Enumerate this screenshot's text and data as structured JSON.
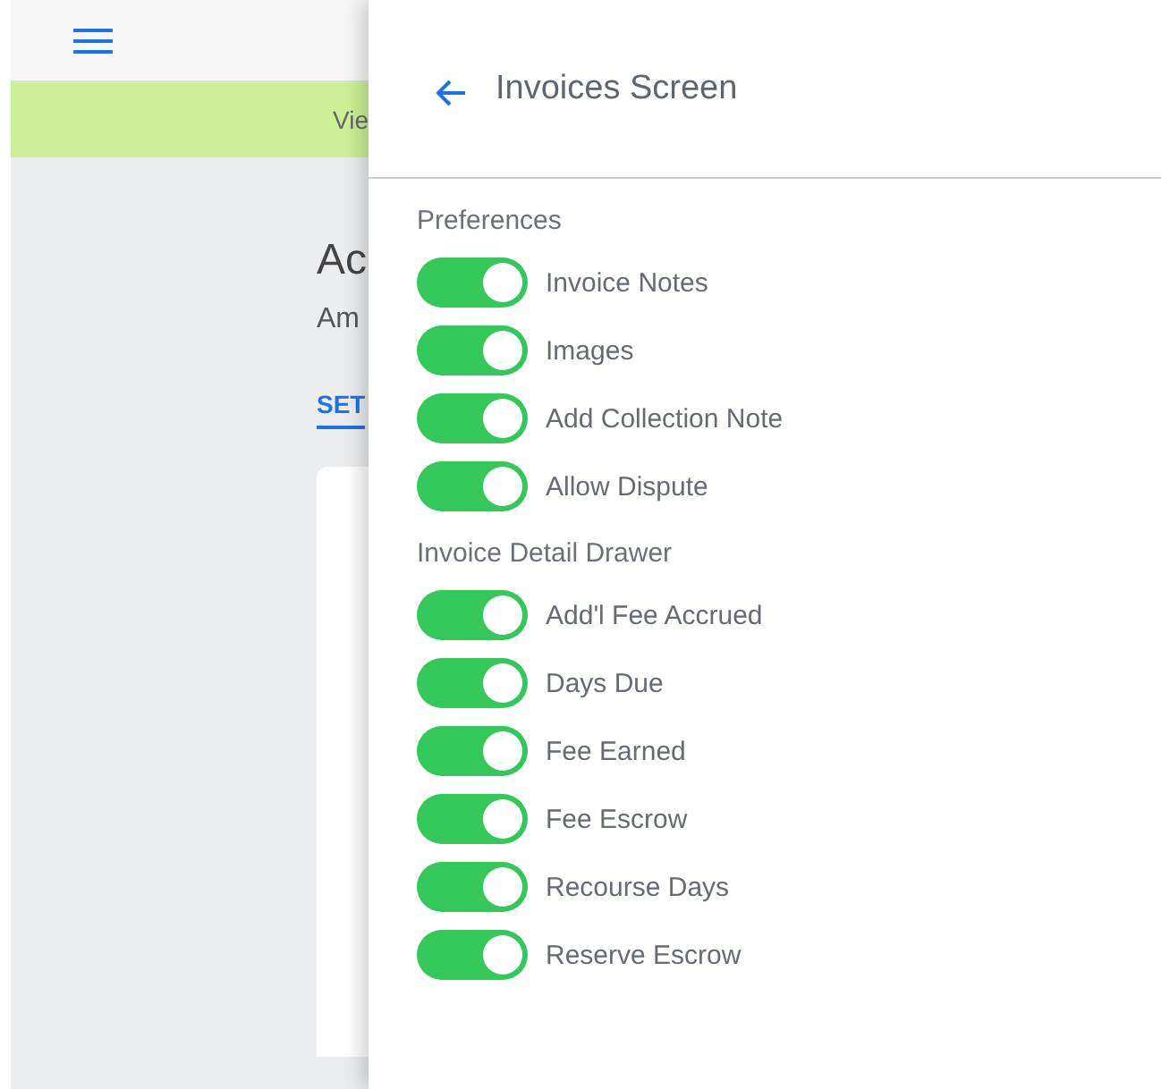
{
  "background": {
    "banner": "Vie",
    "heading": "Ac",
    "subheading": "Am",
    "tab": {
      "label": "SET",
      "selected": true
    }
  },
  "drawer": {
    "title": "Invoices Screen",
    "sections": [
      {
        "title": "Preferences",
        "toggles": [
          {
            "label": "Invoice Notes",
            "on": true
          },
          {
            "label": "Images",
            "on": true
          },
          {
            "label": "Add Collection Note",
            "on": true
          },
          {
            "label": "Allow Dispute",
            "on": true
          }
        ]
      },
      {
        "title": "Invoice Detail Drawer",
        "toggles": [
          {
            "label": "Add'l Fee Accrued",
            "on": true
          },
          {
            "label": "Days Due",
            "on": true
          },
          {
            "label": "Fee Earned",
            "on": true
          },
          {
            "label": "Fee Escrow",
            "on": true
          },
          {
            "label": "Recourse Days",
            "on": true
          },
          {
            "label": "Reserve Escrow",
            "on": true
          }
        ]
      }
    ]
  }
}
